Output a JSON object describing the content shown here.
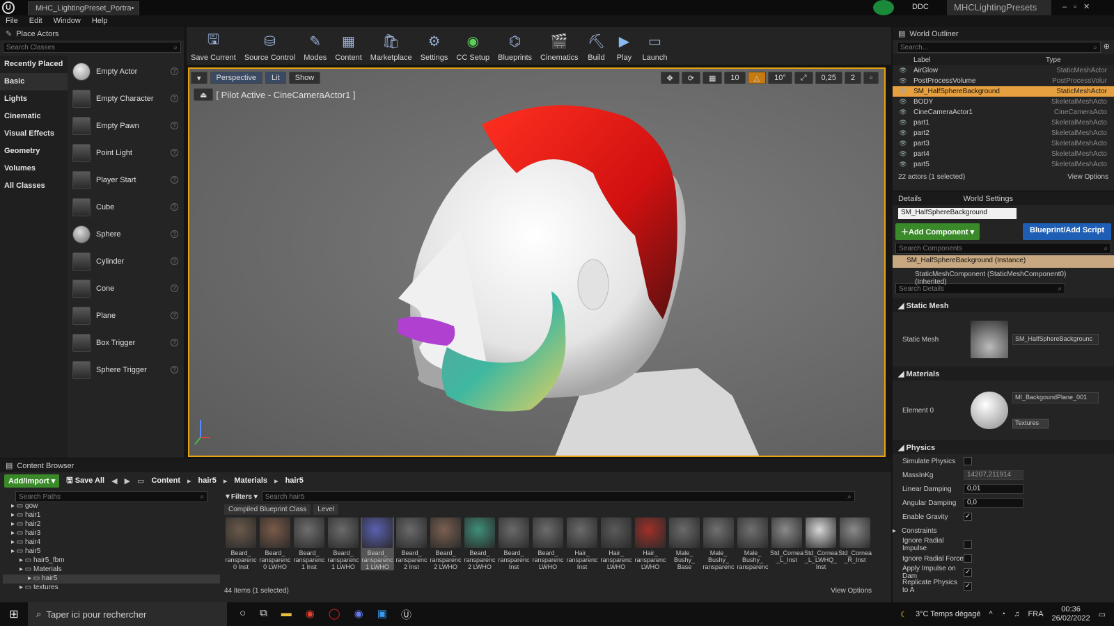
{
  "window": {
    "tab_title": "MHC_LightingPreset_Portra•",
    "app_logo": "U",
    "project_name": "MHCLightingPresets",
    "ddc_label": "DDC"
  },
  "menu": [
    "File",
    "Edit",
    "Window",
    "Help"
  ],
  "place_actors": {
    "title": "Place Actors",
    "search_placeholder": "Search Classes",
    "categories": [
      "Recently Placed",
      "Basic",
      "Lights",
      "Cinematic",
      "Visual Effects",
      "Geometry",
      "Volumes",
      "All Classes"
    ],
    "selected_category": "Basic",
    "items": [
      "Empty Actor",
      "Empty Character",
      "Empty Pawn",
      "Point Light",
      "Player Start",
      "Cube",
      "Sphere",
      "Cylinder",
      "Cone",
      "Plane",
      "Box Trigger",
      "Sphere Trigger"
    ]
  },
  "toolbar": [
    {
      "label": "Save Current",
      "icon": "save-icon"
    },
    {
      "label": "Source Control",
      "icon": "source-control-icon"
    },
    {
      "label": "Modes",
      "icon": "modes-icon"
    },
    {
      "label": "Content",
      "icon": "content-icon"
    },
    {
      "label": "Marketplace",
      "icon": "marketplace-icon"
    },
    {
      "label": "Settings",
      "icon": "settings-icon"
    },
    {
      "label": "CC Setup",
      "icon": "cc-setup-icon"
    },
    {
      "label": "Blueprints",
      "icon": "blueprints-icon"
    },
    {
      "label": "Cinematics",
      "icon": "cinematics-icon"
    },
    {
      "label": "Build",
      "icon": "build-icon"
    },
    {
      "label": "Play",
      "icon": "play-icon"
    },
    {
      "label": "Launch",
      "icon": "launch-icon"
    }
  ],
  "viewport": {
    "perspective": "Perspective",
    "lit": "Lit",
    "show": "Show",
    "pilot_text": "[ Pilot Active - CineCameraActor1 ]",
    "grid_snap": "10",
    "rot_snap": "10°",
    "scale_snap": "0,25",
    "cam_speed": "2"
  },
  "outliner": {
    "title": "World Outliner",
    "search_placeholder": "Search...",
    "col_label": "Label",
    "col_type": "Type",
    "rows": [
      {
        "label": "AirGlow",
        "type": "StaticMeshActor",
        "selected": false
      },
      {
        "label": "PostProcessVolume",
        "type": "PostProcessVolur",
        "selected": false
      },
      {
        "label": "SM_HalfSphereBackground",
        "type": "StaticMeshActor",
        "selected": true
      },
      {
        "label": "BODY",
        "type": "SkeletalMeshActo",
        "selected": false
      },
      {
        "label": "CineCameraActor1",
        "type": "CineCameraActo",
        "selected": false
      },
      {
        "label": "part1",
        "type": "SkeletalMeshActo",
        "selected": false
      },
      {
        "label": "part2",
        "type": "SkeletalMeshActo",
        "selected": false
      },
      {
        "label": "part3",
        "type": "SkeletalMeshActo",
        "selected": false
      },
      {
        "label": "part4",
        "type": "SkeletalMeshActo",
        "selected": false
      },
      {
        "label": "part5",
        "type": "SkeletalMeshActo",
        "selected": false
      }
    ],
    "status": "22 actors (1 selected)",
    "view_options": "View Options"
  },
  "details": {
    "tab_details": "Details",
    "tab_world": "World Settings",
    "actor_name": "SM_HalfSphereBackground",
    "add_component": "Add Component",
    "blueprint_btn": "Blueprint/Add Script",
    "search_components": "Search Components",
    "instance_row": "SM_HalfSphereBackground (Instance)",
    "component_row": "StaticMeshComponent (StaticMeshComponent0) (Inherited)",
    "search_details": "Search Details",
    "static_mesh_section": "Static Mesh",
    "static_mesh_label": "Static Mesh",
    "static_mesh_value": "SM_HalfSphereBackgrounc",
    "materials_section": "Materials",
    "element_label": "Element 0",
    "material_value": "MI_BackgoundPlane_001",
    "textures_btn": "Textures",
    "physics_section": "Physics",
    "physics": [
      {
        "name": "Simulate Physics",
        "kind": "check",
        "checked": false
      },
      {
        "name": "MassInKg",
        "kind": "mass",
        "value": "14207,211914"
      },
      {
        "name": "Linear Damping",
        "kind": "num",
        "value": "0,01"
      },
      {
        "name": "Angular Damping",
        "kind": "num",
        "value": "0,0"
      },
      {
        "name": "Enable Gravity",
        "kind": "check",
        "checked": true
      },
      {
        "name": "Constraints",
        "kind": "group"
      },
      {
        "name": "Ignore Radial Impulse",
        "kind": "check",
        "checked": false
      },
      {
        "name": "Ignore Radial Force",
        "kind": "check",
        "checked": false
      },
      {
        "name": "Apply Impulse on Dam",
        "kind": "check",
        "checked": true
      },
      {
        "name": "Replicate Physics to A",
        "kind": "check",
        "checked": true
      }
    ]
  },
  "content_browser": {
    "title": "Content Browser",
    "add_import": "Add/Import",
    "save_all": "Save All",
    "path": [
      "Content",
      "hair5",
      "Materials",
      "hair5"
    ],
    "search_paths": "Search Paths",
    "filters": "Filters",
    "search_assets": "Search hair5",
    "filter_chips": [
      "Compiled Blueprint Class",
      "Level"
    ],
    "tree": [
      {
        "label": "gow",
        "indent": 1
      },
      {
        "label": "hair1",
        "indent": 1
      },
      {
        "label": "hair2",
        "indent": 1
      },
      {
        "label": "hair3",
        "indent": 1
      },
      {
        "label": "hair4",
        "indent": 1
      },
      {
        "label": "hair5",
        "indent": 1
      },
      {
        "label": "hair5_fbm",
        "indent": 2
      },
      {
        "label": "Materials",
        "indent": 2
      },
      {
        "label": "hair5",
        "indent": 3
      },
      {
        "label": "textures",
        "indent": 2
      }
    ],
    "assets": [
      {
        "name": "Beard_ ransparenc 0 Inst",
        "color": "#6b5a4a"
      },
      {
        "name": "Beard_ ransparenc 0 LWHO",
        "color": "#7a5a48"
      },
      {
        "name": "Beard_ ransparenc 1 Inst",
        "color": "#6e6e6e"
      },
      {
        "name": "Beard_ ransparenc 1 LWHO",
        "color": "#6a6a6a"
      },
      {
        "name": "Beard_ ransparenc 1 LWHO",
        "color": "#5a60b0"
      },
      {
        "name": "Beard_ ransparenc 2 Inst",
        "color": "#6a6a6a"
      },
      {
        "name": "Beard_ ransparenc 2 LWHO",
        "color": "#7a6050"
      },
      {
        "name": "Beard_ ransparenc 2 LWHO",
        "color": "#3f8f7a"
      },
      {
        "name": "Beard_ ransparenc Inst",
        "color": "#6a6a6a"
      },
      {
        "name": "Beard_ ransparenc LWHO",
        "color": "#6c6c6c"
      },
      {
        "name": "Hair_ ransparenc Inst",
        "color": "#6a6a6a"
      },
      {
        "name": "Hair_ ransparenc LWHO",
        "color": "#5a5a5a"
      },
      {
        "name": "Hair_ ransparenc LWHO",
        "color": "#a03028"
      },
      {
        "name": "Male_ Bushy_ Base",
        "color": "#6a6a6a"
      },
      {
        "name": "Male_ Bushy_ ransparenc",
        "color": "#707070"
      },
      {
        "name": "Male_ Bushy_ ransparenc",
        "color": "#707070"
      },
      {
        "name": "Std_Cornea _L_Inst",
        "color": "#8a8a8a"
      },
      {
        "name": "Std_Cornea _L_LWHQ_ Inst",
        "color": "#d8d8d8"
      },
      {
        "name": "Std_Cornea _R_Inst",
        "color": "#8a8a8a"
      }
    ],
    "selected_asset": 4,
    "status": "44 items (1 selected)",
    "view_options": "View Options"
  },
  "taskbar": {
    "search_placeholder": "Taper ici pour rechercher",
    "weather": "3°C Temps dégagé",
    "lang": "FRA",
    "time": "00:36",
    "date": "26/02/2022"
  }
}
